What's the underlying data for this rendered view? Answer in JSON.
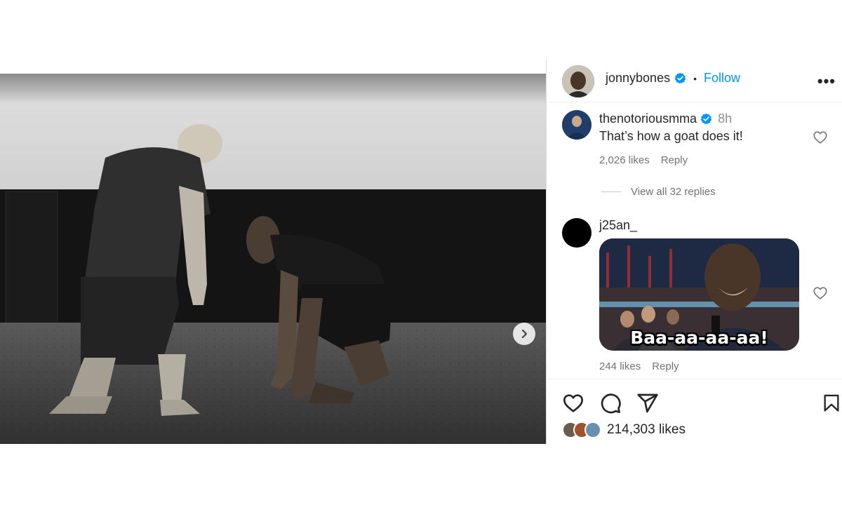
{
  "post": {
    "author": {
      "username": "jonnybones",
      "verified": true,
      "follow_label": "Follow",
      "separator": "•"
    },
    "more_label": "•••",
    "carousel": {
      "slide_count": 7,
      "active_index": 0
    }
  },
  "comments": [
    {
      "username": "thenotoriousmma",
      "verified": true,
      "time": "8h",
      "text": "That’s how a goat does it!",
      "likes": "2,026 likes",
      "reply_label": "Reply",
      "view_replies": "View all 32 replies"
    },
    {
      "username": "j25an_",
      "verified": false,
      "gif_caption": "Baa-aa-aa-aa!",
      "likes": "244 likes",
      "reply_label": "Reply"
    }
  ],
  "actions": {
    "icons": [
      "heart-icon",
      "comment-icon",
      "share-icon",
      "bookmark-icon"
    ],
    "likes_count": "214,303 likes"
  },
  "colors": {
    "accent": "#0095f6",
    "verified": "#0095f6",
    "text": "#262626",
    "muted": "#737373"
  }
}
